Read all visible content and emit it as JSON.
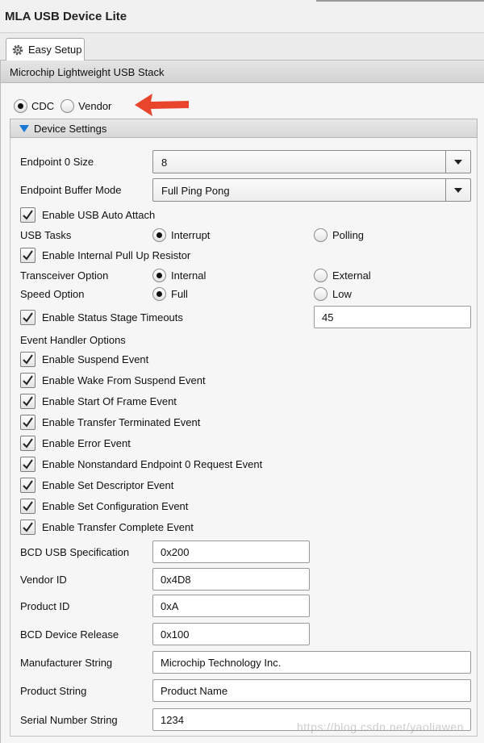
{
  "window": {
    "title": "MLA USB Device Lite"
  },
  "tab": {
    "label": "Easy Setup"
  },
  "stack": {
    "header": "Microchip Lightweight USB Stack"
  },
  "class_type": {
    "options": [
      {
        "label": "CDC",
        "selected": true
      },
      {
        "label": "Vendor",
        "selected": false
      }
    ]
  },
  "device_settings": {
    "header": "Device Settings",
    "endpoint0_size": {
      "label": "Endpoint 0 Size",
      "value": "8"
    },
    "buffer_mode": {
      "label": "Endpoint Buffer Mode",
      "value": "Full Ping Pong"
    },
    "auto_attach": {
      "label": "Enable USB Auto Attach",
      "checked": true
    },
    "usb_tasks": {
      "label": "USB Tasks",
      "opt1": "Interrupt",
      "opt2": "Polling",
      "selected": "Interrupt"
    },
    "pull_up": {
      "label": "Enable Internal Pull Up Resistor",
      "checked": true
    },
    "transceiver": {
      "label": "Transceiver Option",
      "opt1": "Internal",
      "opt2": "External",
      "selected": "Internal"
    },
    "speed": {
      "label": "Speed Option",
      "opt1": "Full",
      "opt2": "Low",
      "selected": "Full"
    },
    "status_timeouts": {
      "label": "Enable Status Stage Timeouts",
      "checked": true,
      "value": "45"
    },
    "event_handler": {
      "label": "Event Handler Options",
      "items": [
        {
          "label": "Enable Suspend Event",
          "checked": true
        },
        {
          "label": "Enable Wake From Suspend Event",
          "checked": true
        },
        {
          "label": "Enable Start Of Frame Event",
          "checked": true
        },
        {
          "label": "Enable Transfer Terminated Event",
          "checked": true
        },
        {
          "label": "Enable Error Event",
          "checked": true
        },
        {
          "label": "Enable Nonstandard Endpoint 0 Request Event",
          "checked": true
        },
        {
          "label": "Enable Set Descriptor Event",
          "checked": true
        },
        {
          "label": "Enable Set Configuration Event",
          "checked": true
        },
        {
          "label": "Enable Transfer Complete Event",
          "checked": true
        }
      ]
    },
    "fields": [
      {
        "label": "BCD USB Specification",
        "value": "0x200"
      },
      {
        "label": "Vendor ID",
        "value": "0x4D8"
      },
      {
        "label": "Product ID",
        "value": "0xA"
      },
      {
        "label": "BCD Device Release",
        "value": "0x100"
      },
      {
        "label": "Manufacturer String",
        "value": "Microchip Technology Inc."
      },
      {
        "label": "Product String",
        "value": "Product Name"
      },
      {
        "label": "Serial Number String",
        "value": "1234"
      }
    ]
  },
  "watermark": "https://blog.csdn.net/yaoliawen",
  "colors": {
    "arrow": "#e8452c",
    "collapse_triangle": "#1a78d6"
  }
}
